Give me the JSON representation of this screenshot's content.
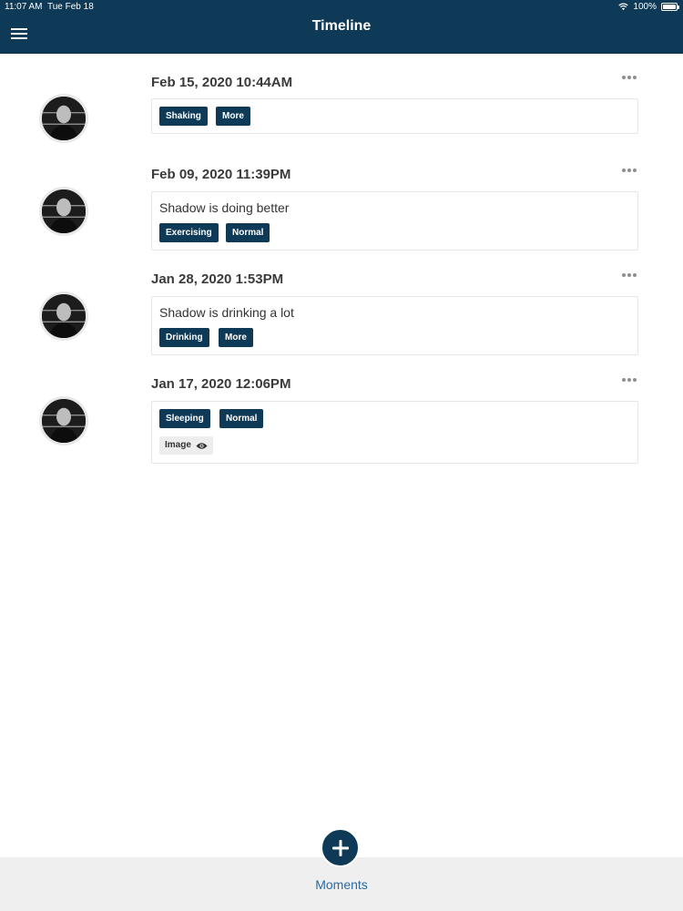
{
  "status_bar": {
    "time": "11:07 AM",
    "date": "Tue Feb 18",
    "battery": "100%"
  },
  "header": {
    "title": "Timeline"
  },
  "entries": [
    {
      "date": "Feb 15, 2020 10:44AM",
      "note": "",
      "tags": [
        "Shaking",
        "More"
      ],
      "attachment": ""
    },
    {
      "date": "Feb 09, 2020 11:39PM",
      "note": "Shadow is doing better",
      "tags": [
        "Exercising",
        "Normal"
      ],
      "attachment": ""
    },
    {
      "date": "Jan 28, 2020 1:53PM",
      "note": "Shadow is drinking a lot",
      "tags": [
        "Drinking",
        "More"
      ],
      "attachment": ""
    },
    {
      "date": "Jan 17, 2020 12:06PM",
      "note": "",
      "tags": [
        "Sleeping",
        "Normal"
      ],
      "attachment": "Image"
    }
  ],
  "bottom_nav": {
    "label": "Moments"
  },
  "colors": {
    "brand": "#0f3a57",
    "tab_text": "#2b6aa0",
    "bottom_bar": "#efefef"
  },
  "icons": {
    "menu": "menu-icon",
    "more": "more-horizontal-icon",
    "view": "eye-icon",
    "add": "plus-icon"
  }
}
